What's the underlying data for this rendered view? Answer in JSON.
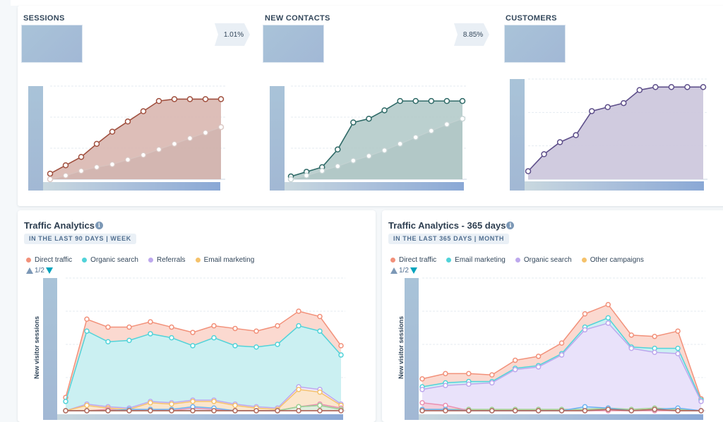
{
  "funnel": {
    "stages": [
      {
        "title": "SESSIONS"
      },
      {
        "title": "NEW CONTACTS"
      },
      {
        "title": "CUSTOMERS"
      }
    ],
    "conversions": [
      "1.01%",
      "8.85%"
    ]
  },
  "colors": {
    "sessions": "#a0503f",
    "sessions_fill": "#d9b7b0",
    "contacts": "#2f6a67",
    "contacts_fill": "#b4cbca",
    "customers": "#5e4f8a",
    "customers_fill": "#cdc8dd",
    "direct": "#f2917a",
    "organic": "#51d3d9",
    "referrals": "#bda8ed",
    "email": "#f5c26b",
    "pink": "#ea90b1",
    "blue": "#6ab2f2",
    "green": "#a2d28f",
    "brown": "#b36a5e"
  },
  "traffic90": {
    "title": "Traffic Analytics",
    "badge": "IN THE LAST 90 DAYS | WEEK",
    "pager": "1/2",
    "ylabel": "New visitor sessions"
  },
  "traffic365": {
    "title": "Traffic Analytics - 365 days",
    "badge": "IN THE LAST 365 DAYS | MONTH",
    "pager": "1/2",
    "ylabel": "New visitor sessions"
  },
  "chart_data": [
    {
      "type": "area",
      "title": "SESSIONS",
      "x": [
        1,
        2,
        3,
        4,
        5,
        6,
        7,
        8,
        9,
        10,
        11,
        12
      ],
      "ylim": [
        0,
        100
      ],
      "series": [
        {
          "name": "current",
          "values": [
            6,
            15,
            24,
            38,
            51,
            62,
            73,
            84,
            86,
            86,
            86,
            86
          ]
        },
        {
          "name": "comparison",
          "values": [
            0,
            4,
            9,
            13,
            16,
            21,
            26,
            32,
            38,
            44,
            50,
            56
          ]
        }
      ]
    },
    {
      "type": "area",
      "title": "NEW CONTACTS",
      "x": [
        1,
        2,
        3,
        4,
        5,
        6,
        7,
        8,
        9,
        10,
        11,
        12
      ],
      "ylim": [
        0,
        100
      ],
      "series": [
        {
          "name": "current",
          "values": [
            3,
            8,
            13,
            32,
            61,
            65,
            74,
            84,
            84,
            84,
            84,
            84
          ]
        },
        {
          "name": "comparison",
          "values": [
            0,
            4,
            9,
            14,
            20,
            25,
            31,
            38,
            45,
            52,
            59,
            65
          ]
        }
      ]
    },
    {
      "type": "area",
      "title": "CUSTOMERS",
      "x": [
        1,
        2,
        3,
        4,
        5,
        6,
        7,
        8,
        9,
        10,
        11,
        12
      ],
      "ylim": [
        0,
        100
      ],
      "series": [
        {
          "name": "current",
          "values": [
            8,
            25,
            37,
            44,
            68,
            72,
            76,
            89,
            92,
            92,
            92,
            92
          ]
        }
      ]
    },
    {
      "type": "area",
      "title": "Traffic Analytics",
      "subtitle": "IN THE LAST 90 DAYS | WEEK",
      "ylabel": "New visitor sessions",
      "x": [
        1,
        2,
        3,
        4,
        5,
        6,
        7,
        8,
        9,
        10,
        11,
        12,
        13,
        14
      ],
      "ylim": [
        0,
        100
      ],
      "stacked": true,
      "legend": [
        "Direct traffic",
        "Organic search",
        "Referrals",
        "Email marketing"
      ],
      "series": [
        {
          "name": "Direct traffic",
          "values": [
            10,
            69,
            63,
            63,
            67,
            63,
            59,
            64,
            62,
            60,
            64,
            75,
            71,
            49
          ]
        },
        {
          "name": "Organic search",
          "values": [
            7,
            60,
            52,
            53,
            58,
            55,
            49,
            55,
            49,
            48,
            50,
            64,
            60,
            42
          ]
        },
        {
          "name": "Referrals",
          "values": [
            0,
            5,
            3,
            2,
            7,
            6,
            8,
            8,
            5,
            3,
            2,
            18,
            16,
            5
          ]
        },
        {
          "name": "Email marketing",
          "values": [
            0,
            4,
            2,
            1,
            6,
            5,
            7,
            7,
            4,
            2,
            1,
            16,
            14,
            4
          ]
        },
        {
          "name": "other-pink",
          "values": [
            0,
            0,
            1,
            0,
            1,
            0,
            2,
            1,
            0,
            0,
            0,
            3,
            5,
            2
          ]
        },
        {
          "name": "other-blue",
          "values": [
            0,
            0,
            0,
            1,
            1,
            1,
            3,
            2,
            0,
            0,
            0,
            3,
            4,
            1
          ]
        },
        {
          "name": "other-green",
          "values": [
            0,
            0,
            0,
            0,
            0,
            0,
            0,
            0,
            0,
            0,
            0,
            3,
            4,
            1
          ]
        },
        {
          "name": "other-brown",
          "values": [
            0,
            0,
            0,
            0,
            0,
            0,
            0,
            0,
            0,
            0,
            0,
            0,
            0,
            0
          ]
        }
      ]
    },
    {
      "type": "area",
      "title": "Traffic Analytics - 365 days",
      "subtitle": "IN THE LAST 365 DAYS | MONTH",
      "ylabel": "New visitor sessions",
      "x": [
        1,
        2,
        3,
        4,
        5,
        6,
        7,
        8,
        9,
        10,
        11,
        12,
        13
      ],
      "ylim": [
        0,
        100
      ],
      "stacked": true,
      "legend": [
        "Direct traffic",
        "Email marketing",
        "Organic search",
        "Other campaigns"
      ],
      "series": [
        {
          "name": "Direct traffic",
          "values": [
            24,
            28,
            28,
            27,
            38,
            41,
            51,
            73,
            80,
            57,
            56,
            60,
            9
          ]
        },
        {
          "name": "Email marketing",
          "values": [
            18,
            21,
            22,
            22,
            32,
            34,
            43,
            63,
            70,
            48,
            47,
            47,
            8
          ]
        },
        {
          "name": "Organic search",
          "values": [
            16,
            19,
            20,
            21,
            31,
            33,
            42,
            61,
            66,
            47,
            44,
            43,
            7
          ]
        },
        {
          "name": "Other campaigns",
          "values": [
            1,
            1,
            1,
            1,
            1,
            1,
            1,
            1,
            2,
            1,
            2,
            1,
            0
          ]
        },
        {
          "name": "other-pink",
          "values": [
            6,
            4,
            0,
            0,
            0,
            0,
            0,
            0,
            0,
            0,
            0,
            0,
            0
          ]
        },
        {
          "name": "other-blue",
          "values": [
            1,
            1,
            0,
            0,
            0,
            0,
            0,
            3,
            2,
            0,
            1,
            2,
            0
          ]
        },
        {
          "name": "other-brown",
          "values": [
            0,
            0,
            0,
            0,
            0,
            0,
            0,
            0,
            1,
            0,
            1,
            0,
            0
          ]
        }
      ]
    }
  ]
}
